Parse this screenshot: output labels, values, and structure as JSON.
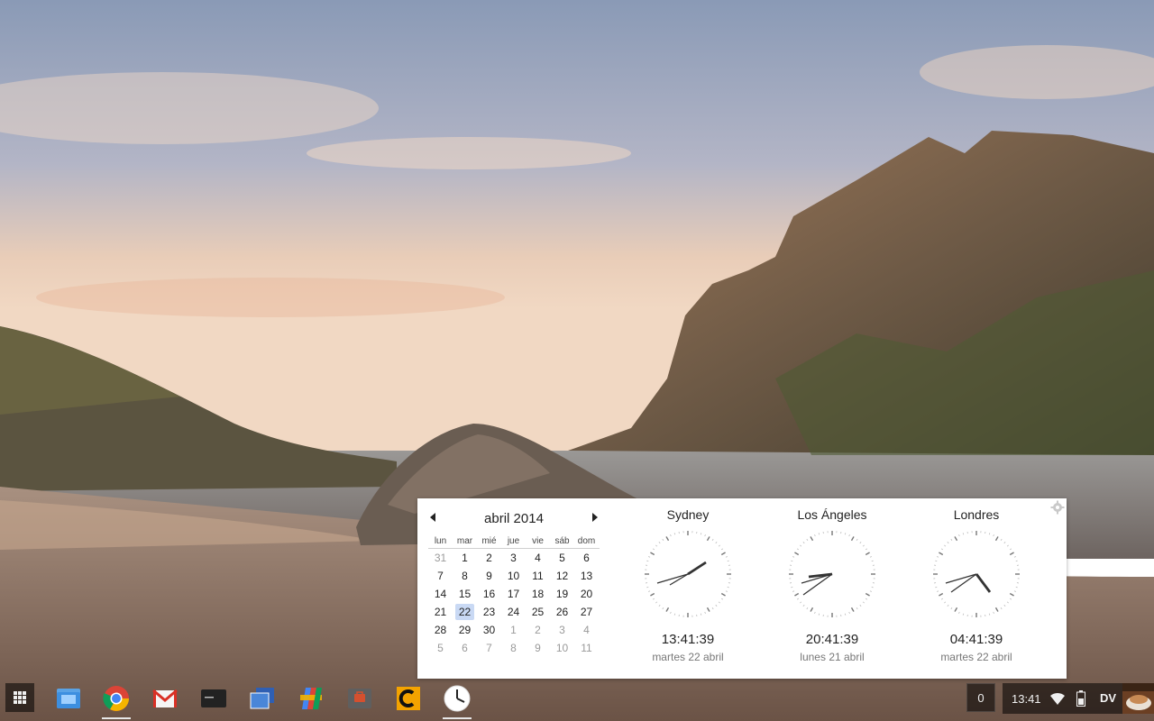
{
  "calendar": {
    "title": "abril 2014",
    "weekdays": [
      "lun",
      "mar",
      "mié",
      "jue",
      "vie",
      "sáb",
      "dom"
    ],
    "weeks": [
      [
        "31",
        "1",
        "2",
        "3",
        "4",
        "5",
        "6"
      ],
      [
        "7",
        "8",
        "9",
        "10",
        "11",
        "12",
        "13"
      ],
      [
        "14",
        "15",
        "16",
        "17",
        "18",
        "19",
        "20"
      ],
      [
        "21",
        "22",
        "23",
        "24",
        "25",
        "26",
        "27"
      ],
      [
        "28",
        "29",
        "30",
        "1",
        "2",
        "3",
        "4"
      ],
      [
        "5",
        "6",
        "7",
        "8",
        "9",
        "10",
        "11"
      ]
    ],
    "today": "22"
  },
  "clocks": [
    {
      "city": "Sydney",
      "time": "13:41:39",
      "date": "martes 22 abril"
    },
    {
      "city": "Los Ángeles",
      "time": "20:41:39",
      "date": "lunes 21 abril"
    },
    {
      "city": "Londres",
      "time": "04:41:39",
      "date": "martes 22 abril"
    }
  ],
  "shelf": {
    "apps": [
      "app-launcher-icon",
      "files-icon",
      "chrome-icon",
      "gmail-icon",
      "terminal-icon",
      "window-switcher-icon",
      "google-drive-icon",
      "briefcase-icon",
      "c-app-icon",
      "clock-icon"
    ]
  },
  "tray": {
    "notifications": "0",
    "time": "13:41",
    "user": "DV"
  },
  "colors": {
    "today_highlight": "#c9d9f4",
    "tray_bg": "#1a1a1a"
  }
}
